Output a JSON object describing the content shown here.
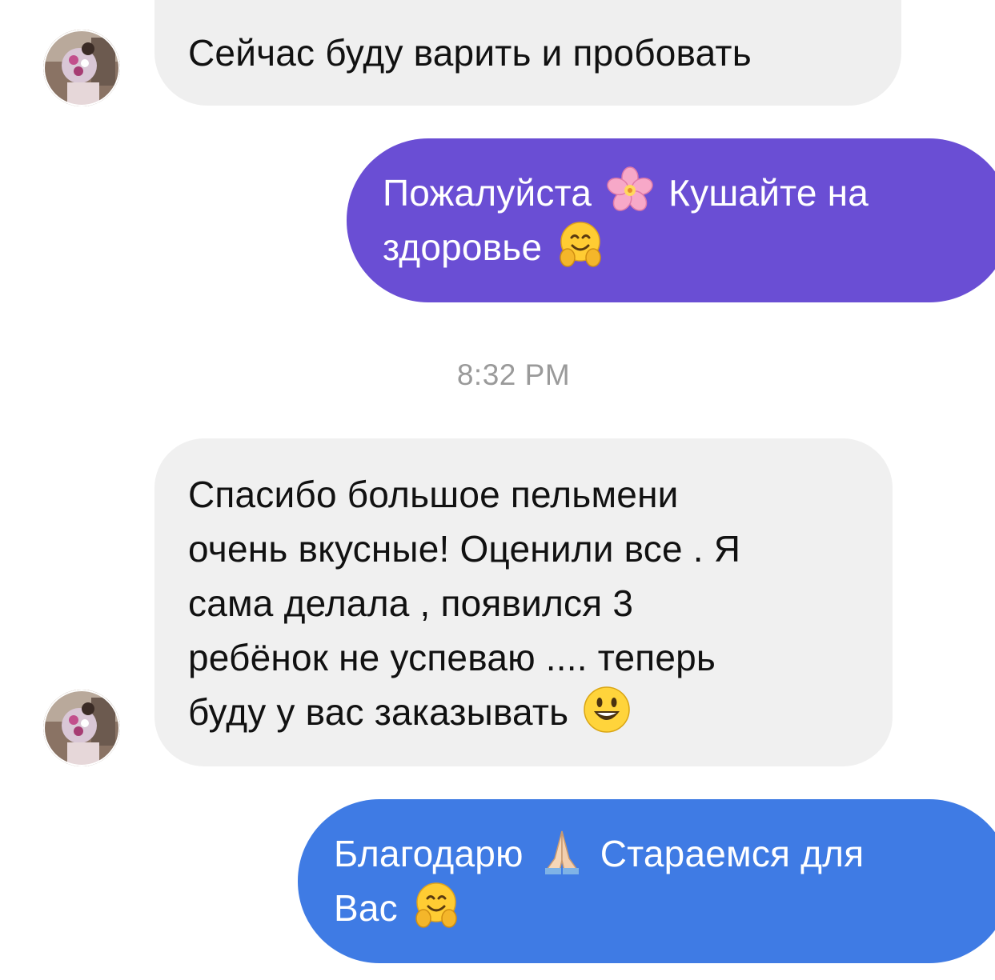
{
  "messages": [
    {
      "id": "msg1",
      "direction": "incoming",
      "text": "Сейчас буду варить и пробовать"
    },
    {
      "id": "msg2",
      "direction": "outgoing",
      "color": "#6a4ed4",
      "line1a": "Пожалуйста",
      "line1b": "Кушайте на",
      "line2": "здоровье",
      "emojis": [
        "cherry-blossom-icon",
        "hugging-face-icon"
      ]
    },
    {
      "id": "msg3",
      "direction": "incoming",
      "lines": [
        "Спасибо большое пельмени",
        "очень вкусные! Оценили все . Я",
        "сама делала , появился 3",
        "ребёнок не успеваю .... теперь",
        "буду у вас заказывать"
      ],
      "emojis": [
        "smiley-face-icon"
      ]
    },
    {
      "id": "msg4",
      "direction": "outgoing",
      "color": "#3f7be4",
      "line1a": "Благодарю",
      "line1b": "Стараемся для",
      "line2": "Вас",
      "emojis": [
        "folded-hands-icon",
        "hugging-face-icon"
      ]
    }
  ],
  "timestamp": "8:32 PM",
  "colors": {
    "incoming_bubble": "#efefef",
    "outgoing_purple": "#6a4ed4",
    "outgoing_blue": "#3f7be4",
    "timestamp_text": "#9a9a9a"
  }
}
